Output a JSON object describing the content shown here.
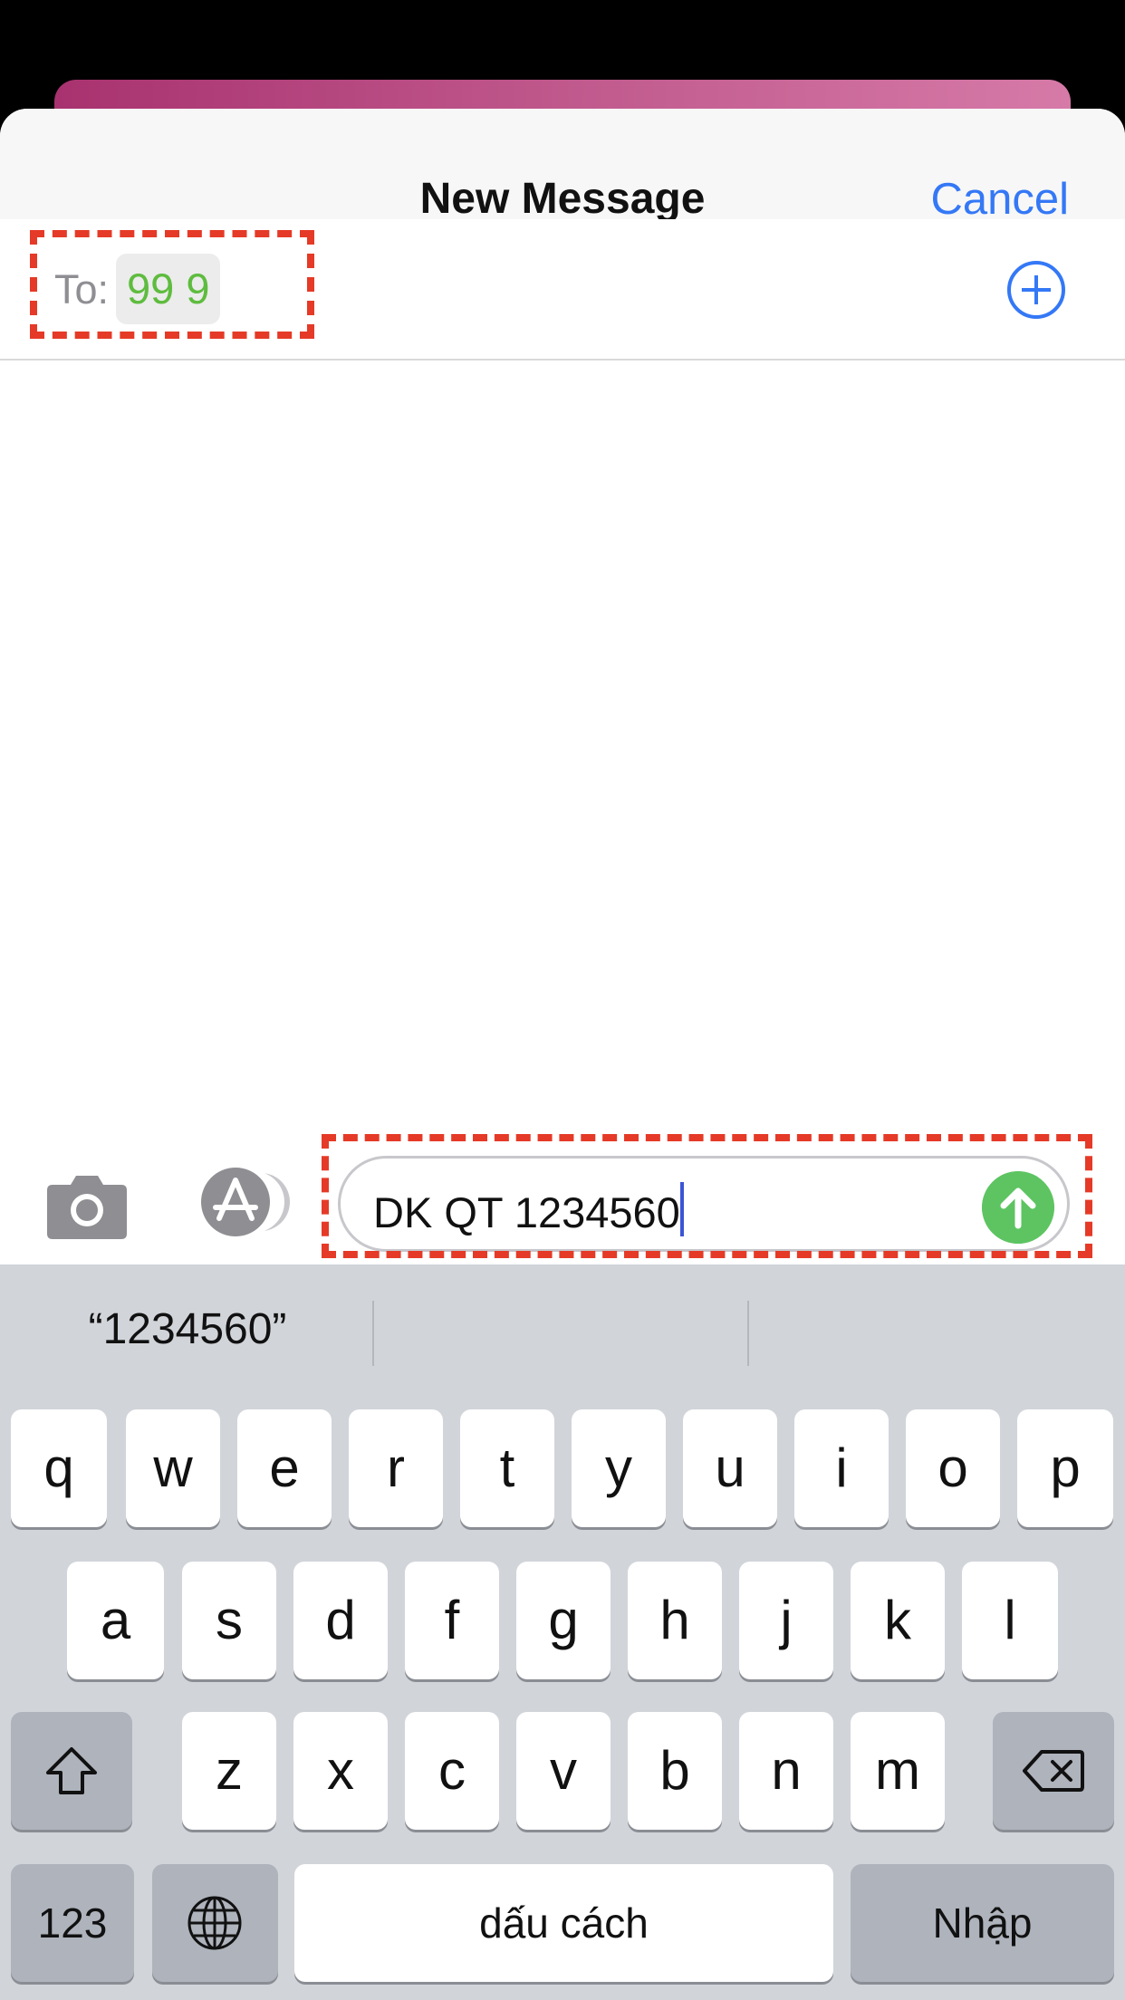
{
  "nav": {
    "title": "New Message",
    "cancel_label": "Cancel"
  },
  "recipient": {
    "to_label": "To:",
    "value": "99 9"
  },
  "compose": {
    "message_text": "DK QT 1234560"
  },
  "keyboard": {
    "suggestion": "“1234560”",
    "row1": [
      "q",
      "w",
      "e",
      "r",
      "t",
      "y",
      "u",
      "i",
      "o",
      "p"
    ],
    "row2": [
      "a",
      "s",
      "d",
      "f",
      "g",
      "h",
      "j",
      "k",
      "l"
    ],
    "row3": [
      "z",
      "x",
      "c",
      "v",
      "b",
      "n",
      "m"
    ],
    "numbers_label": "123",
    "space_label": "dấu cách",
    "return_label": "Nhập"
  },
  "icons": [
    "plus-circle-icon",
    "camera-icon",
    "app-store-icon",
    "send-arrow-icon",
    "shift-icon",
    "backspace-icon",
    "globe-icon"
  ],
  "colors": {
    "accent": "#3478f6",
    "recipient": "#5ebc3e",
    "send": "#5dc461",
    "highlight": "#e53a27"
  }
}
